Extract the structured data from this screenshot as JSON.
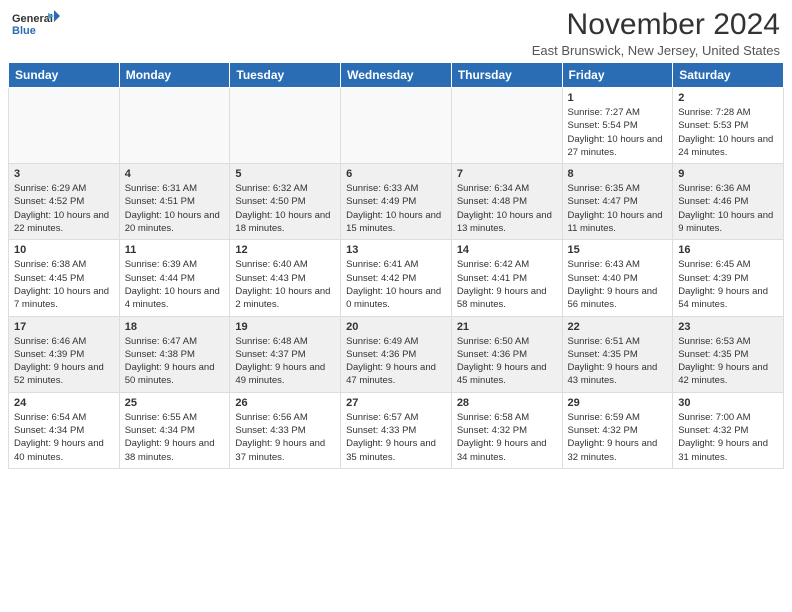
{
  "header": {
    "logo_general": "General",
    "logo_blue": "Blue",
    "month_title": "November 2024",
    "location": "East Brunswick, New Jersey, United States"
  },
  "calendar": {
    "days_of_week": [
      "Sunday",
      "Monday",
      "Tuesday",
      "Wednesday",
      "Thursday",
      "Friday",
      "Saturday"
    ],
    "weeks": [
      {
        "cells": [
          {
            "day": "",
            "info": ""
          },
          {
            "day": "",
            "info": ""
          },
          {
            "day": "",
            "info": ""
          },
          {
            "day": "",
            "info": ""
          },
          {
            "day": "",
            "info": ""
          },
          {
            "day": "1",
            "info": "Sunrise: 7:27 AM\nSunset: 5:54 PM\nDaylight: 10 hours and 27 minutes."
          },
          {
            "day": "2",
            "info": "Sunrise: 7:28 AM\nSunset: 5:53 PM\nDaylight: 10 hours and 24 minutes."
          }
        ]
      },
      {
        "cells": [
          {
            "day": "3",
            "info": "Sunrise: 6:29 AM\nSunset: 4:52 PM\nDaylight: 10 hours and 22 minutes."
          },
          {
            "day": "4",
            "info": "Sunrise: 6:31 AM\nSunset: 4:51 PM\nDaylight: 10 hours and 20 minutes."
          },
          {
            "day": "5",
            "info": "Sunrise: 6:32 AM\nSunset: 4:50 PM\nDaylight: 10 hours and 18 minutes."
          },
          {
            "day": "6",
            "info": "Sunrise: 6:33 AM\nSunset: 4:49 PM\nDaylight: 10 hours and 15 minutes."
          },
          {
            "day": "7",
            "info": "Sunrise: 6:34 AM\nSunset: 4:48 PM\nDaylight: 10 hours and 13 minutes."
          },
          {
            "day": "8",
            "info": "Sunrise: 6:35 AM\nSunset: 4:47 PM\nDaylight: 10 hours and 11 minutes."
          },
          {
            "day": "9",
            "info": "Sunrise: 6:36 AM\nSunset: 4:46 PM\nDaylight: 10 hours and 9 minutes."
          }
        ]
      },
      {
        "cells": [
          {
            "day": "10",
            "info": "Sunrise: 6:38 AM\nSunset: 4:45 PM\nDaylight: 10 hours and 7 minutes."
          },
          {
            "day": "11",
            "info": "Sunrise: 6:39 AM\nSunset: 4:44 PM\nDaylight: 10 hours and 4 minutes."
          },
          {
            "day": "12",
            "info": "Sunrise: 6:40 AM\nSunset: 4:43 PM\nDaylight: 10 hours and 2 minutes."
          },
          {
            "day": "13",
            "info": "Sunrise: 6:41 AM\nSunset: 4:42 PM\nDaylight: 10 hours and 0 minutes."
          },
          {
            "day": "14",
            "info": "Sunrise: 6:42 AM\nSunset: 4:41 PM\nDaylight: 9 hours and 58 minutes."
          },
          {
            "day": "15",
            "info": "Sunrise: 6:43 AM\nSunset: 4:40 PM\nDaylight: 9 hours and 56 minutes."
          },
          {
            "day": "16",
            "info": "Sunrise: 6:45 AM\nSunset: 4:39 PM\nDaylight: 9 hours and 54 minutes."
          }
        ]
      },
      {
        "cells": [
          {
            "day": "17",
            "info": "Sunrise: 6:46 AM\nSunset: 4:39 PM\nDaylight: 9 hours and 52 minutes."
          },
          {
            "day": "18",
            "info": "Sunrise: 6:47 AM\nSunset: 4:38 PM\nDaylight: 9 hours and 50 minutes."
          },
          {
            "day": "19",
            "info": "Sunrise: 6:48 AM\nSunset: 4:37 PM\nDaylight: 9 hours and 49 minutes."
          },
          {
            "day": "20",
            "info": "Sunrise: 6:49 AM\nSunset: 4:36 PM\nDaylight: 9 hours and 47 minutes."
          },
          {
            "day": "21",
            "info": "Sunrise: 6:50 AM\nSunset: 4:36 PM\nDaylight: 9 hours and 45 minutes."
          },
          {
            "day": "22",
            "info": "Sunrise: 6:51 AM\nSunset: 4:35 PM\nDaylight: 9 hours and 43 minutes."
          },
          {
            "day": "23",
            "info": "Sunrise: 6:53 AM\nSunset: 4:35 PM\nDaylight: 9 hours and 42 minutes."
          }
        ]
      },
      {
        "cells": [
          {
            "day": "24",
            "info": "Sunrise: 6:54 AM\nSunset: 4:34 PM\nDaylight: 9 hours and 40 minutes."
          },
          {
            "day": "25",
            "info": "Sunrise: 6:55 AM\nSunset: 4:34 PM\nDaylight: 9 hours and 38 minutes."
          },
          {
            "day": "26",
            "info": "Sunrise: 6:56 AM\nSunset: 4:33 PM\nDaylight: 9 hours and 37 minutes."
          },
          {
            "day": "27",
            "info": "Sunrise: 6:57 AM\nSunset: 4:33 PM\nDaylight: 9 hours and 35 minutes."
          },
          {
            "day": "28",
            "info": "Sunrise: 6:58 AM\nSunset: 4:32 PM\nDaylight: 9 hours and 34 minutes."
          },
          {
            "day": "29",
            "info": "Sunrise: 6:59 AM\nSunset: 4:32 PM\nDaylight: 9 hours and 32 minutes."
          },
          {
            "day": "30",
            "info": "Sunrise: 7:00 AM\nSunset: 4:32 PM\nDaylight: 9 hours and 31 minutes."
          }
        ]
      }
    ]
  },
  "colors": {
    "header_bg": "#2a6db5",
    "header_text": "#ffffff",
    "row_odd": "#ffffff",
    "row_even": "#f2f2f2"
  }
}
